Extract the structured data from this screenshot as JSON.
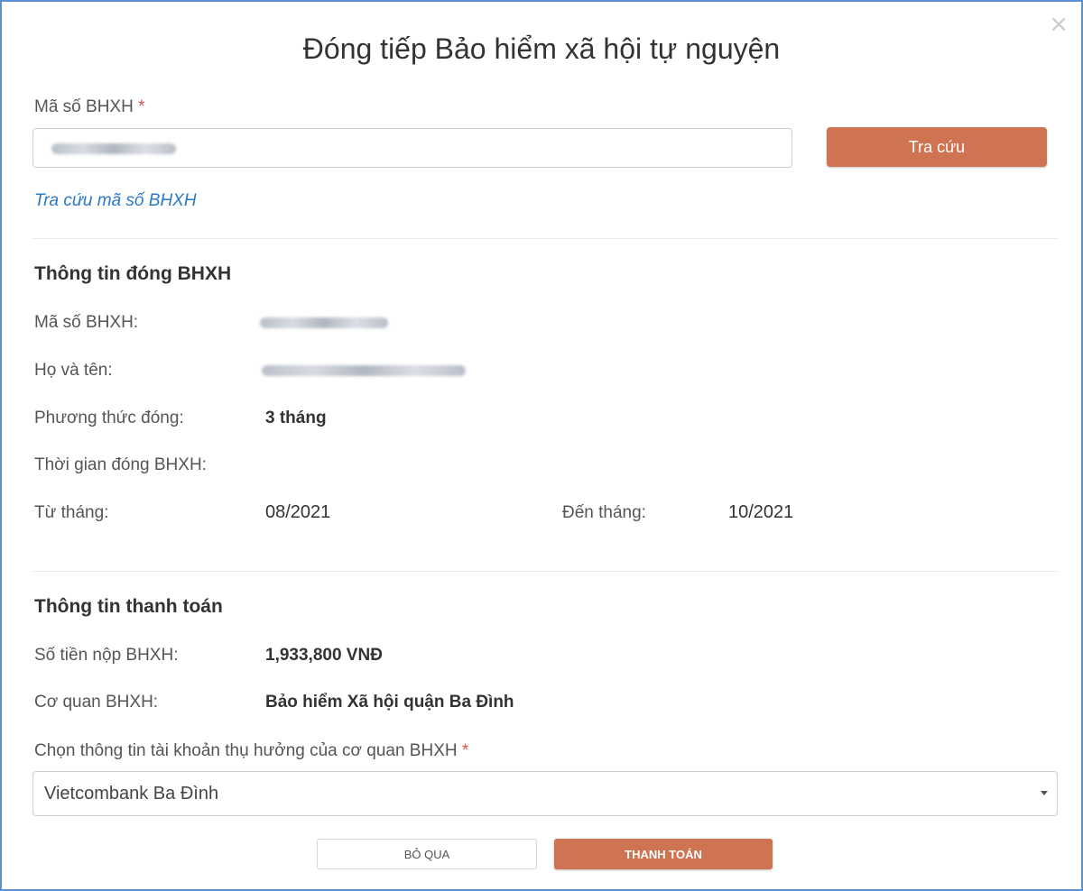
{
  "modal": {
    "title": "Đóng tiếp Bảo hiểm xã hội tự nguyện",
    "close_glyph": "×"
  },
  "lookup": {
    "label": "Mã số BHXH",
    "required_mark": "*",
    "input_value": "",
    "button_label": "Tra cứu",
    "link_text": "Tra cứu mã số BHXH"
  },
  "payment_info": {
    "section_title": "Thông tin đóng BHXH",
    "code_label": "Mã số BHXH:",
    "name_label": "Họ và tên:",
    "method_label": "Phương thức đóng:",
    "method_value": "3 tháng",
    "period_label": "Thời gian đóng BHXH:",
    "from_label": "Từ tháng:",
    "from_value": "08/2021",
    "to_label": "Đến tháng:",
    "to_value": "10/2021"
  },
  "billing": {
    "section_title": "Thông tin thanh toán",
    "amount_label": "Số tiền nộp BHXH:",
    "amount_value": "1,933,800 VNĐ",
    "agency_label": "Cơ quan BHXH:",
    "agency_value": "Bảo hiểm Xã hội quận Ba Đình",
    "account_label": "Chọn thông tin tài khoản thụ hưởng của cơ quan BHXH",
    "required_mark": "*",
    "account_selected": "Vietcombank Ba Đình"
  },
  "actions": {
    "skip_label": "BỎ QUA",
    "pay_label": "THANH TOÁN"
  },
  "colors": {
    "accent": "#cf7452",
    "link": "#2a79c8",
    "required": "#d9534f"
  }
}
